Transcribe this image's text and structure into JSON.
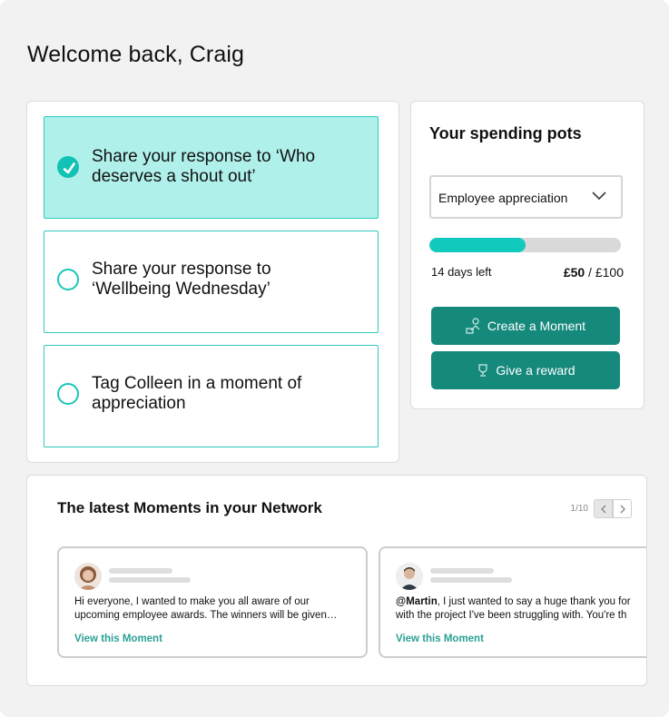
{
  "welcome": "Welcome back, Craig",
  "tasks": [
    {
      "label": "Share your response to ‘Who deserves a shout out’",
      "done": true
    },
    {
      "label": "Share your response to ‘Wellbeing Wednesday’",
      "done": false
    },
    {
      "label": "Tag Colleen in a moment of appreciation",
      "done": false
    }
  ],
  "pots": {
    "title": "Your spending pots",
    "selected": "Employee appreciation",
    "progress": 0.5,
    "days_left": "14 days left",
    "spent": "£50",
    "separator": " / ",
    "total": "£100",
    "create_label": "Create a Moment",
    "reward_label": "Give a reward"
  },
  "feed": {
    "title": "The latest Moments in your Network",
    "page": "1/10",
    "moments": [
      {
        "mention": "",
        "text": "Hi everyone, I wanted to make you all aware of our\nupcoming employee awards. The winners will be given…",
        "link": "View this Moment"
      },
      {
        "mention": "@Martin",
        "text": ", I just wanted to say a huge thank you for\nwith the project I've been struggling with. You're th",
        "link": "View this Moment"
      }
    ]
  },
  "colors": {
    "accent": "#12c9be",
    "button": "#16897d",
    "task_done_bg": "#b0f0ea",
    "link": "#2aa196"
  },
  "icons": [
    "check-icon",
    "chevron-down-icon",
    "create-moment-icon",
    "reward-icon",
    "chevron-left-icon",
    "chevron-right-icon"
  ]
}
